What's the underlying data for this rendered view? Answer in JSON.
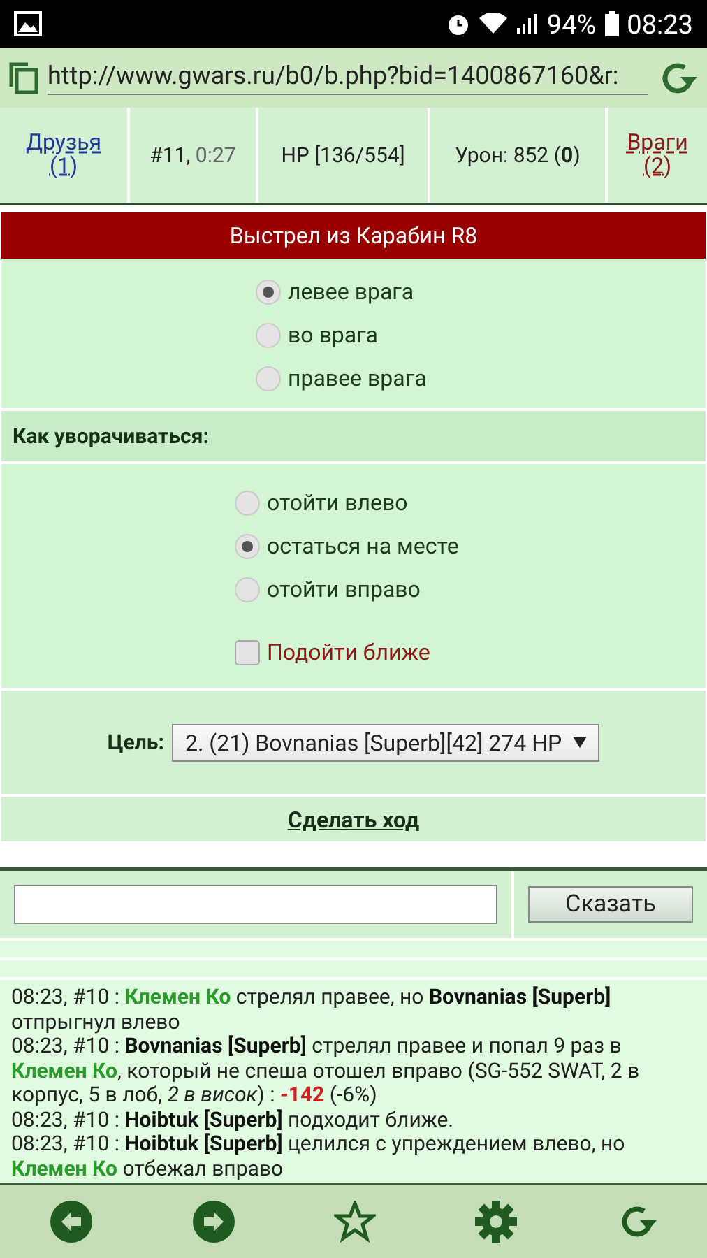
{
  "status_bar": {
    "battery": "94%",
    "time": "08:23"
  },
  "address_bar": {
    "url": "http://www.gwars.ru/b0/b.php?bid=1400867160&r:"
  },
  "stats": {
    "friends": {
      "label": "Друзья",
      "count": "(1)"
    },
    "turn": "#11,",
    "timer": "0:27",
    "hp": "HP [136/554]",
    "damage_label": "Урон: 852 (",
    "damage_bonus": "0",
    "damage_close": ")",
    "enemies": {
      "label": "Враги",
      "count": "(2)"
    }
  },
  "shot": {
    "title": "Выстрел из Карабин R8",
    "options": [
      {
        "label": "левее врага",
        "selected": true
      },
      {
        "label": "во врага",
        "selected": false
      },
      {
        "label": "правее врага",
        "selected": false
      }
    ]
  },
  "dodge": {
    "title": "Как уворачиваться:",
    "options": [
      {
        "label": "отойти влево",
        "selected": false
      },
      {
        "label": "остаться на месте",
        "selected": true
      },
      {
        "label": "отойти вправо",
        "selected": false
      }
    ],
    "approach": {
      "label": "Подойти ближе",
      "checked": false
    }
  },
  "target": {
    "label": "Цель:",
    "value": "2. (21) Bovnanias [Superb][42] 274 HP"
  },
  "submit": "Сделать ход",
  "chat": {
    "button": "Сказать"
  },
  "log": [
    [
      {
        "kind": "plain",
        "text": "08:23, #10 : "
      },
      {
        "kind": "friend",
        "text": "Клемен Ко"
      },
      {
        "kind": "plain",
        "text": " стрелял правее, но "
      },
      {
        "kind": "enemy",
        "text": "Bovnanias [Superb]"
      },
      {
        "kind": "plain",
        "text": " отпрыгнул влево"
      }
    ],
    [
      {
        "kind": "plain",
        "text": "08:23, #10 : "
      },
      {
        "kind": "enemy",
        "text": "Bovnanias [Superb]"
      },
      {
        "kind": "plain",
        "text": " стрелял правее и попал 9 раз в "
      },
      {
        "kind": "friend",
        "text": "Клемен Ко"
      },
      {
        "kind": "plain",
        "text": ", который не спеша отошел вправо (SG-552 SWAT, 2 в корпус, 5 в лоб, "
      },
      {
        "kind": "italic",
        "text": "2 в висок"
      },
      {
        "kind": "plain",
        "text": ") : "
      },
      {
        "kind": "damage",
        "text": "-142"
      },
      {
        "kind": "plain",
        "text": " (-6%)"
      }
    ],
    [
      {
        "kind": "plain",
        "text": "08:23, #10 : "
      },
      {
        "kind": "enemy",
        "text": "Hoibtuk [Superb]"
      },
      {
        "kind": "plain",
        "text": " подходит ближе."
      }
    ],
    [
      {
        "kind": "plain",
        "text": "08:23, #10 : "
      },
      {
        "kind": "enemy",
        "text": "Hoibtuk [Superb]"
      },
      {
        "kind": "plain",
        "text": " целился с упреждением влево, но "
      },
      {
        "kind": "friend",
        "text": "Клемен Ко"
      },
      {
        "kind": "plain",
        "text": " отбежал вправо"
      }
    ]
  ]
}
